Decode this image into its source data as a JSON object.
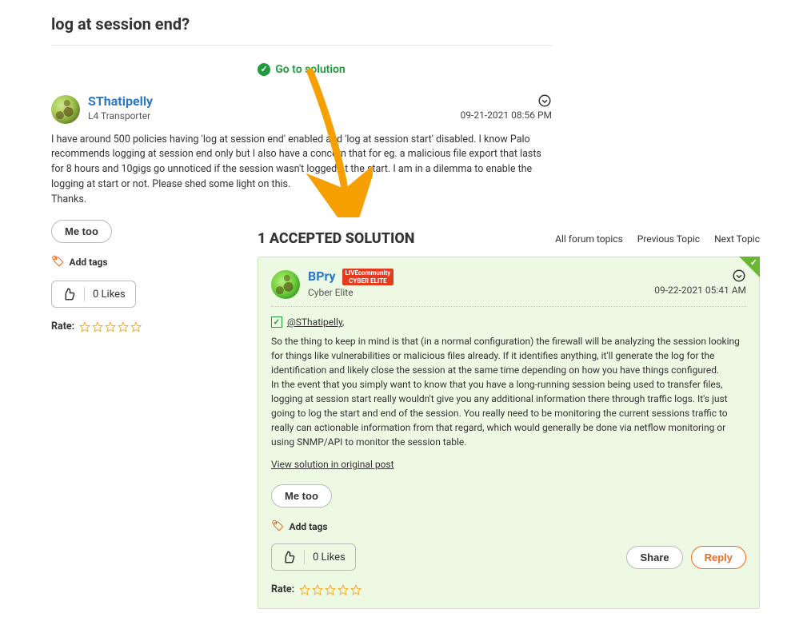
{
  "question": {
    "title": "log at session end?",
    "go_solution": "Go to solution",
    "author": "SThatipelly",
    "rank": "L4 Transporter",
    "date": "09-21-2021",
    "time": "08:56 PM",
    "body1": "I have around 500 policies having 'log at session end' enabled and 'log at session start' disabled. I know Palo recommends logging at session end only but I also have a concern that for eg. a malicious file export that lasts for 8 hours and 10gigs go unnoticed if the session wasn't logged at the start. I am in a dilemma to enable the logging at start or not. Please shed some light on this.",
    "body2": "Thanks.",
    "me_too": "Me too",
    "add_tags": "Add tags",
    "likes": "0 Likes",
    "rate": "Rate:"
  },
  "solution": {
    "heading": "1 ACCEPTED SOLUTION",
    "nav": {
      "all": "All forum topics",
      "prev": "Previous Topic",
      "next": "Next Topic"
    },
    "author": "BPry",
    "badge_line1": "LIVEcommunity",
    "badge_line2": "CYBER ELITE",
    "rank": "Cyber Elite",
    "date": "09-22-2021",
    "time": "05:41 AM",
    "mention": "@SThatipelly",
    "mention_suffix": ",",
    "p1": "So the thing to keep in mind is that (in a normal configuration) the firewall will be analyzing the session looking for things like vulnerabilities or malicious files already. If it identifies anything, it'll generate the log for the identification and likely close the session at the same time depending on how you have things configured.",
    "p2": "In the event that you simply want to know that you have a long-running session being used to transfer files, logging at session start really wouldn't give you any additional information there through traffic logs. It's just going to log the start and end of the session. You really need to be monitoring the current sessions traffic to really can actionable information from that regard, which would generally be done via netflow monitoring or using SNMP/API to monitor the session table.",
    "view_original": "View solution in original post",
    "me_too": "Me too",
    "add_tags": "Add tags",
    "likes": "0 Likes",
    "share": "Share",
    "reply": "Reply",
    "rate": "Rate:"
  }
}
